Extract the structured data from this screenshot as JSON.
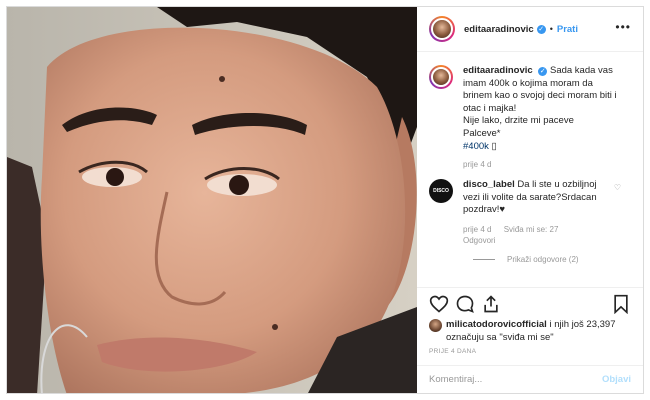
{
  "post": {
    "username": "editaaradinovic",
    "follow_label": "Prati",
    "separator": "•",
    "more_icon": "more-horizontal-icon",
    "image_alt_icon": "close-up-portrait-photo"
  },
  "caption": {
    "username": "editaaradinovic",
    "lines": [
      "Sada kada vas",
      "imam 400k o kojima moram da",
      "brinem kao o svojoj deci moram biti i",
      "otac i majka!",
      "Nije lako, drzite mi paceve",
      "Palceve*"
    ],
    "hashtag": "#400k",
    "emoji": "▯",
    "time": "prije 4 d"
  },
  "comments": [
    {
      "avatar_label": "DISCO",
      "username": "disco_label",
      "text_lines": [
        "Da li ste u ozbiljnoj",
        "vezi ili volite da sarate?Srdacan",
        "pozdrav!♥"
      ],
      "time": "prije 4 d",
      "likes": "Sviđa mi se: 27",
      "reply": "Odgovori",
      "view_replies": "Prikaži odgovore (2)"
    }
  ],
  "actions": {
    "like_icon": "heart-icon",
    "comment_icon": "comment-icon",
    "share_icon": "share-icon",
    "save_icon": "bookmark-icon"
  },
  "likes": {
    "user": "milicatodorovicofficial",
    "rest": " i njih još 23,397",
    "line2": "označuju sa \"sviđa mi se\""
  },
  "date": "PRIJE 4 DANA",
  "add_comment": {
    "placeholder": "Komentiraj...",
    "post_label": "Objavi"
  },
  "colors": {
    "accent": "#3897f0",
    "hashtag": "#003569",
    "muted": "#999999",
    "border": "#dbdbdb"
  }
}
